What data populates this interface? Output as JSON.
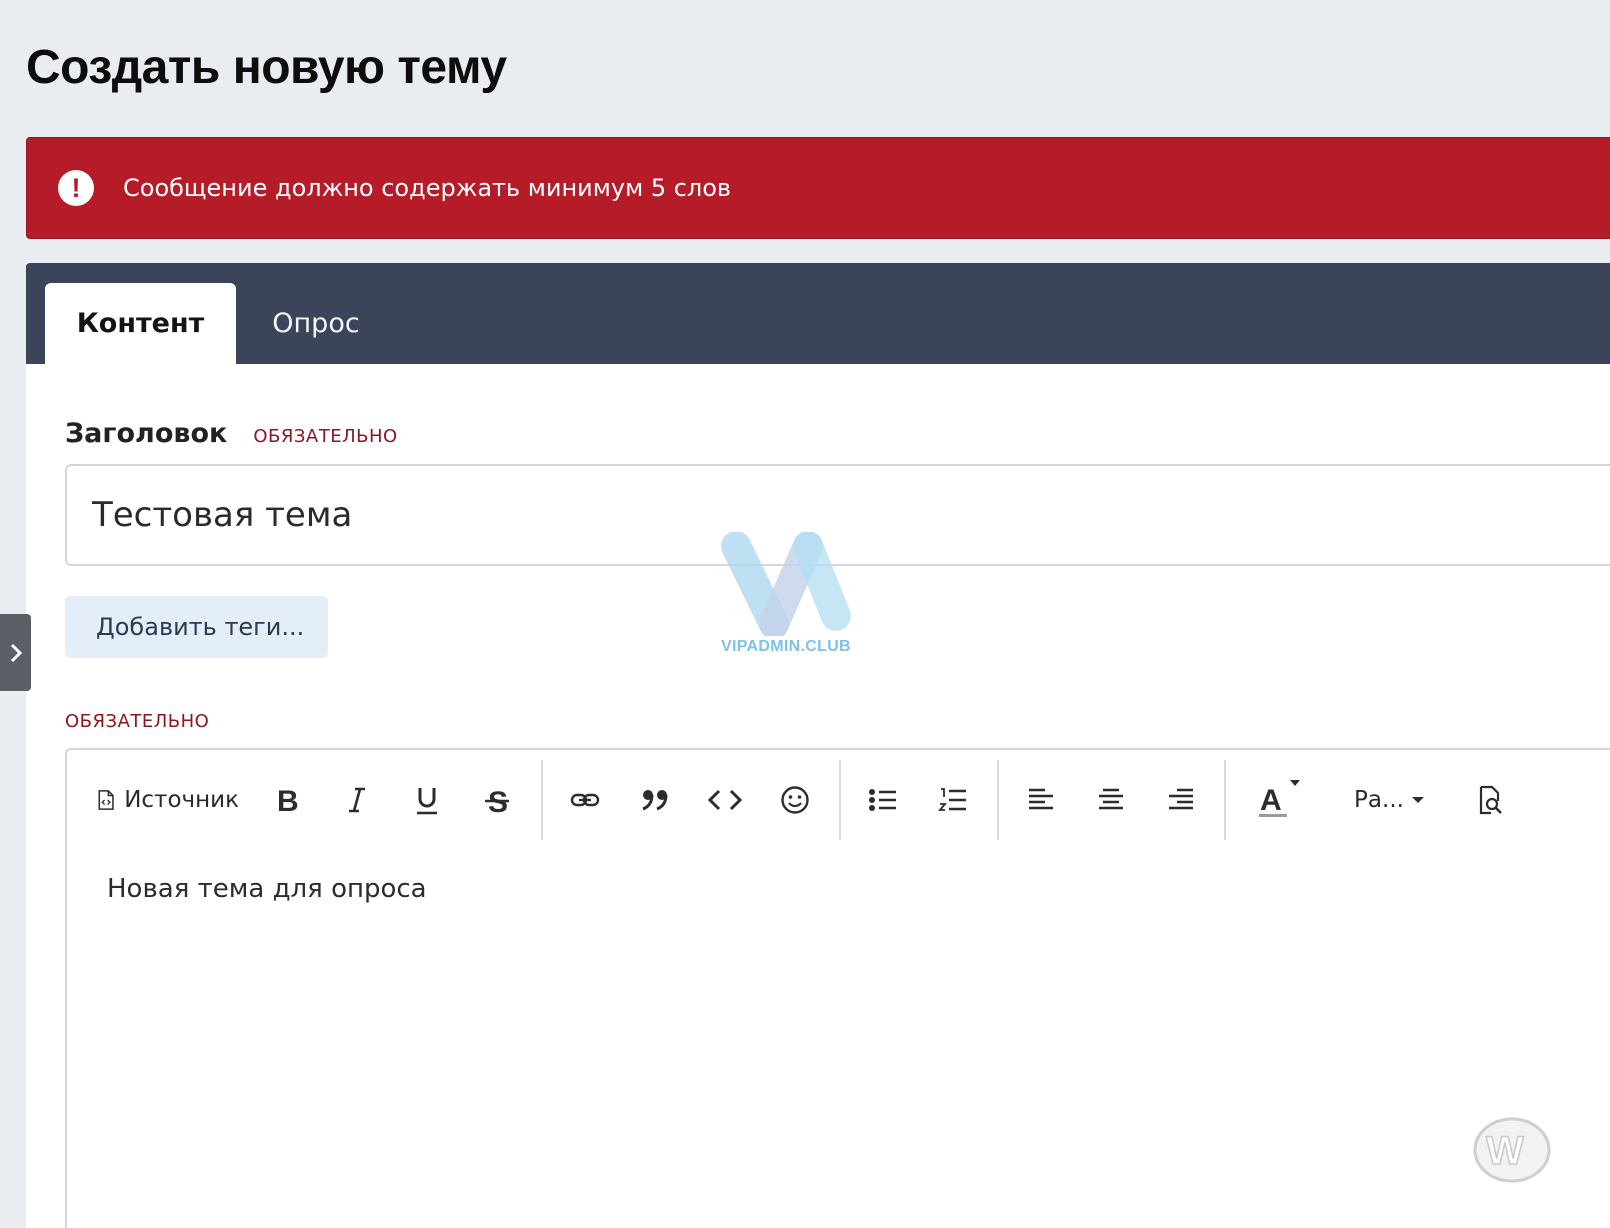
{
  "page": {
    "title": "Создать новую тему"
  },
  "error": {
    "message": "Сообщение должно содержать минимум 5 слов"
  },
  "tabs": [
    {
      "label": "Контент",
      "active": true
    },
    {
      "label": "Опрос",
      "active": false
    }
  ],
  "form": {
    "title_label": "Заголовок",
    "required_label": "ОБЯЗАТЕЛЬНО",
    "title_value": "Тестовая тема",
    "tags_button": "Добавить теги...",
    "message_required_label": "ОБЯЗАТЕЛЬНО"
  },
  "editor": {
    "source_label": "Источник",
    "font_size_label": "Ра...",
    "body": "Новая тема для опроса"
  },
  "watermark": {
    "text": "VIPADMIN.CLUB"
  },
  "colors": {
    "error_bg": "#b61b28",
    "tabs_bg": "#3b4458",
    "page_bg": "#e9ecf1",
    "required_text": "#8c1722",
    "tags_bg": "#e3eef9"
  }
}
